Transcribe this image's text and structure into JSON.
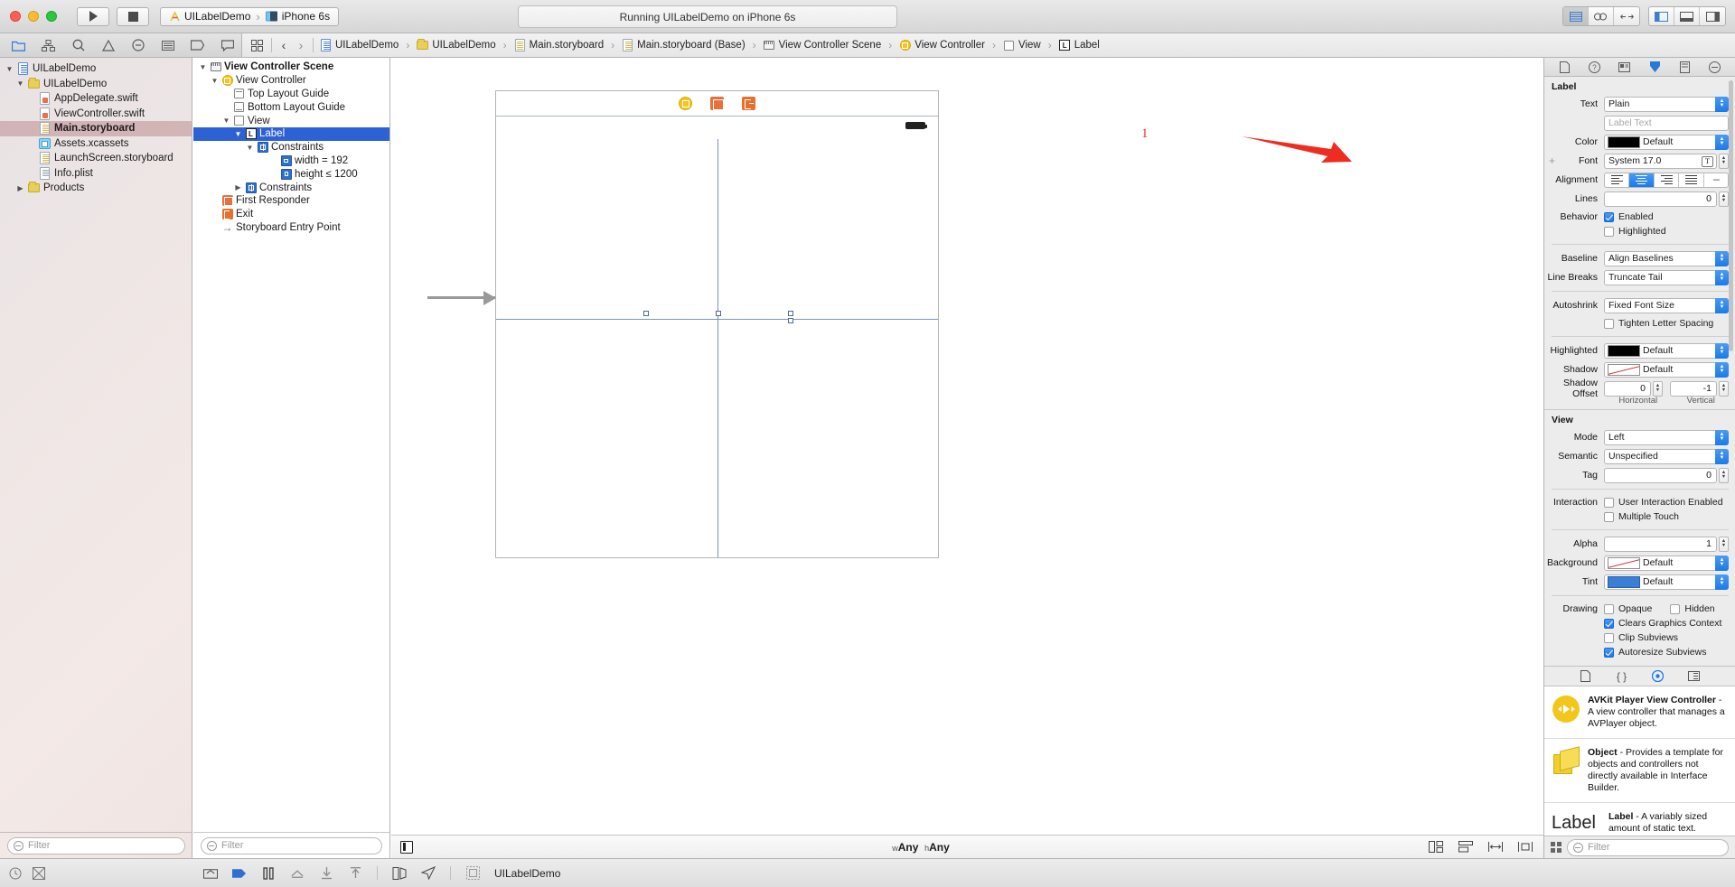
{
  "titlebar": {
    "run_icon": "play-icon",
    "stop_icon": "stop-icon",
    "scheme_project": "UILabelDemo",
    "scheme_separator": "›",
    "scheme_device": "iPhone 6s",
    "status": "Running UILabelDemo on iPhone 6s"
  },
  "navbar": {
    "icons": [
      "folder-icon",
      "source-control-icon",
      "search-icon",
      "warning-icon",
      "test-icon",
      "report-icon",
      "breakpoint-icon",
      "log-icon"
    ],
    "jump_grid_icon": "grid-icon",
    "back_icon": "‹",
    "forward_icon": "›",
    "breadcrumbs": [
      {
        "icon": "document-icon",
        "label": "UILabelDemo"
      },
      {
        "icon": "folder-icon",
        "label": "UILabelDemo"
      },
      {
        "icon": "storyboard-icon",
        "label": "Main.storyboard"
      },
      {
        "icon": "storyboard-icon",
        "label": "Main.storyboard (Base)"
      },
      {
        "icon": "scene-icon",
        "label": "View Controller Scene"
      },
      {
        "icon": "viewcontroller-icon",
        "label": "View Controller"
      },
      {
        "icon": "view-icon",
        "label": "View"
      },
      {
        "icon": "label-icon",
        "label": "Label"
      }
    ]
  },
  "navigator": {
    "items": [
      {
        "label": "UILabelDemo",
        "indent": 0,
        "disc": "▼",
        "icon": "project-icon",
        "selected": false,
        "bold": false
      },
      {
        "label": "UILabelDemo",
        "indent": 1,
        "disc": "▼",
        "icon": "folder-icon",
        "selected": false,
        "bold": false
      },
      {
        "label": "AppDelegate.swift",
        "indent": 2,
        "disc": "",
        "icon": "swift-icon",
        "selected": false,
        "bold": false
      },
      {
        "label": "ViewController.swift",
        "indent": 2,
        "disc": "",
        "icon": "swift-icon",
        "selected": false,
        "bold": false
      },
      {
        "label": "Main.storyboard",
        "indent": 2,
        "disc": "",
        "icon": "storyboard-icon",
        "selected": true,
        "bold": true
      },
      {
        "label": "Assets.xcassets",
        "indent": 2,
        "disc": "",
        "icon": "assets-icon",
        "selected": false,
        "bold": false
      },
      {
        "label": "LaunchScreen.storyboard",
        "indent": 2,
        "disc": "",
        "icon": "storyboard-icon",
        "selected": false,
        "bold": false
      },
      {
        "label": "Info.plist",
        "indent": 2,
        "disc": "",
        "icon": "plist-icon",
        "selected": false,
        "bold": false
      },
      {
        "label": "Products",
        "indent": 1,
        "disc": "▶",
        "icon": "folder-icon",
        "selected": false,
        "bold": false
      }
    ],
    "filter_placeholder": "Filter"
  },
  "outline": {
    "items": [
      {
        "label": "View Controller Scene",
        "indent": 0,
        "disc": "▼",
        "icon": "scene-icon",
        "selected": false,
        "bold": true
      },
      {
        "label": "View Controller",
        "indent": 1,
        "disc": "▼",
        "icon": "viewcontroller-icon",
        "selected": false,
        "bold": false
      },
      {
        "label": "Top Layout Guide",
        "indent": 2,
        "disc": "",
        "icon": "top-guide-icon",
        "selected": false,
        "bold": false
      },
      {
        "label": "Bottom Layout Guide",
        "indent": 2,
        "disc": "",
        "icon": "bottom-guide-icon",
        "selected": false,
        "bold": false
      },
      {
        "label": "View",
        "indent": 2,
        "disc": "▼",
        "icon": "view-icon",
        "selected": false,
        "bold": false
      },
      {
        "label": "Label",
        "indent": 3,
        "disc": "▼",
        "icon": "label-icon",
        "selected": true,
        "bold": false
      },
      {
        "label": "Constraints",
        "indent": 4,
        "disc": "▼",
        "icon": "constraints-icon",
        "selected": false,
        "bold": false
      },
      {
        "label": "width = 192",
        "indent": 5,
        "disc": "",
        "icon": "width-constraint-icon",
        "selected": false,
        "bold": false
      },
      {
        "label": "height ≤ 1200",
        "indent": 5,
        "disc": "",
        "icon": "height-constraint-icon",
        "selected": false,
        "bold": false
      },
      {
        "label": "Constraints",
        "indent": 3,
        "disc": "▶",
        "icon": "constraints-icon",
        "selected": false,
        "bold": false
      },
      {
        "label": "First Responder",
        "indent": 1,
        "disc": "",
        "icon": "first-responder-icon",
        "selected": false,
        "bold": false
      },
      {
        "label": "Exit",
        "indent": 1,
        "disc": "",
        "icon": "exit-icon",
        "selected": false,
        "bold": false
      },
      {
        "label": "Storyboard Entry Point",
        "indent": 1,
        "disc": "",
        "icon": "entry-point-icon",
        "selected": false,
        "bold": false
      }
    ],
    "filter_placeholder": "Filter"
  },
  "canvas": {
    "scene_bar_icons": [
      "view-controller-icon",
      "first-responder-icon",
      "exit-icon"
    ],
    "annotation_number": "1",
    "size_class": {
      "w_prefix": "w",
      "w_value": "Any",
      "h_prefix": "h",
      "h_value": "Any"
    }
  },
  "inspector": {
    "tabs": [
      "file-inspector-icon",
      "quick-help-icon",
      "identity-inspector-icon",
      "attributes-inspector-icon",
      "size-inspector-icon",
      "connections-inspector-icon"
    ],
    "active_tab_index": 3,
    "label_section": {
      "title": "Label",
      "text_label": "Text",
      "text_value": "Plain",
      "text_field_placeholder": "Label Text",
      "color_label": "Color",
      "color_value": "Default",
      "color_swatch": "#000000",
      "font_label": "Font",
      "font_value": "System 17.0",
      "alignment_label": "Alignment",
      "alignment_options": [
        "left",
        "center",
        "right",
        "justified",
        "natural"
      ],
      "alignment_selected": 1,
      "lines_label": "Lines",
      "lines_value": "0",
      "behavior_label": "Behavior",
      "behavior_enabled_label": "Enabled",
      "behavior_enabled_checked": true,
      "behavior_highlighted_label": "Highlighted",
      "behavior_highlighted_checked": false,
      "baseline_label": "Baseline",
      "baseline_value": "Align Baselines",
      "line_breaks_label": "Line Breaks",
      "line_breaks_value": "Truncate Tail",
      "autoshrink_label": "Autoshrink",
      "autoshrink_value": "Fixed Font Size",
      "tighten_label": "Tighten Letter Spacing",
      "tighten_checked": false,
      "highlighted_label": "Highlighted",
      "highlighted_value": "Default",
      "shadow_label": "Shadow",
      "shadow_value": "Default",
      "shadow_offset_label": "Shadow Offset",
      "shadow_offset_h": "0",
      "shadow_offset_v": "-1",
      "shadow_sub_h": "Horizontal",
      "shadow_sub_v": "Vertical"
    },
    "view_section": {
      "title": "View",
      "mode_label": "Mode",
      "mode_value": "Left",
      "semantic_label": "Semantic",
      "semantic_value": "Unspecified",
      "tag_label": "Tag",
      "tag_value": "0",
      "interaction_label": "Interaction",
      "user_interaction_label": "User Interaction Enabled",
      "user_interaction_checked": false,
      "multiple_touch_label": "Multiple Touch",
      "multiple_touch_checked": false,
      "alpha_label": "Alpha",
      "alpha_value": "1",
      "background_label": "Background",
      "background_value": "Default",
      "tint_label": "Tint",
      "tint_value": "Default",
      "tint_swatch": "#3a7fd5",
      "drawing_label": "Drawing",
      "opaque_label": "Opaque",
      "opaque_checked": false,
      "hidden_label": "Hidden",
      "hidden_checked": false,
      "clears_graphics_label": "Clears Graphics Context",
      "clears_graphics_checked": true,
      "clip_subviews_label": "Clip Subviews",
      "clip_subviews_checked": false,
      "autoresize_label": "Autoresize Subviews",
      "autoresize_checked": true
    },
    "library": {
      "tabs": [
        "file-template-library-icon",
        "code-snippet-library-icon",
        "object-library-icon",
        "media-library-icon"
      ],
      "active_tab_index": 2,
      "items": [
        {
          "icon": "avkit-player-icon",
          "title": "AVKit Player View Controller",
          "desc": " - A view controller that manages a AVPlayer object."
        },
        {
          "icon": "object-cube-icon",
          "title": "Object",
          "desc": " - Provides a template for objects and controllers not directly available in Interface Builder."
        },
        {
          "icon": "label-big-icon",
          "big_text": "Label",
          "title": "Label",
          "desc": " - A variably sized amount of static text."
        }
      ],
      "filter_placeholder": "Filter"
    }
  },
  "bottombar": {
    "left_icons": [
      "clock-icon",
      "breakpoint-toggle-icon"
    ],
    "tools": [
      "console-icon",
      "step-icon",
      "pause-icon",
      "step-over-icon",
      "step-into-icon",
      "step-out-icon",
      "view-debug-icon",
      "location-icon"
    ],
    "process_icon": "process-icon",
    "process_label": "UILabelDemo"
  }
}
